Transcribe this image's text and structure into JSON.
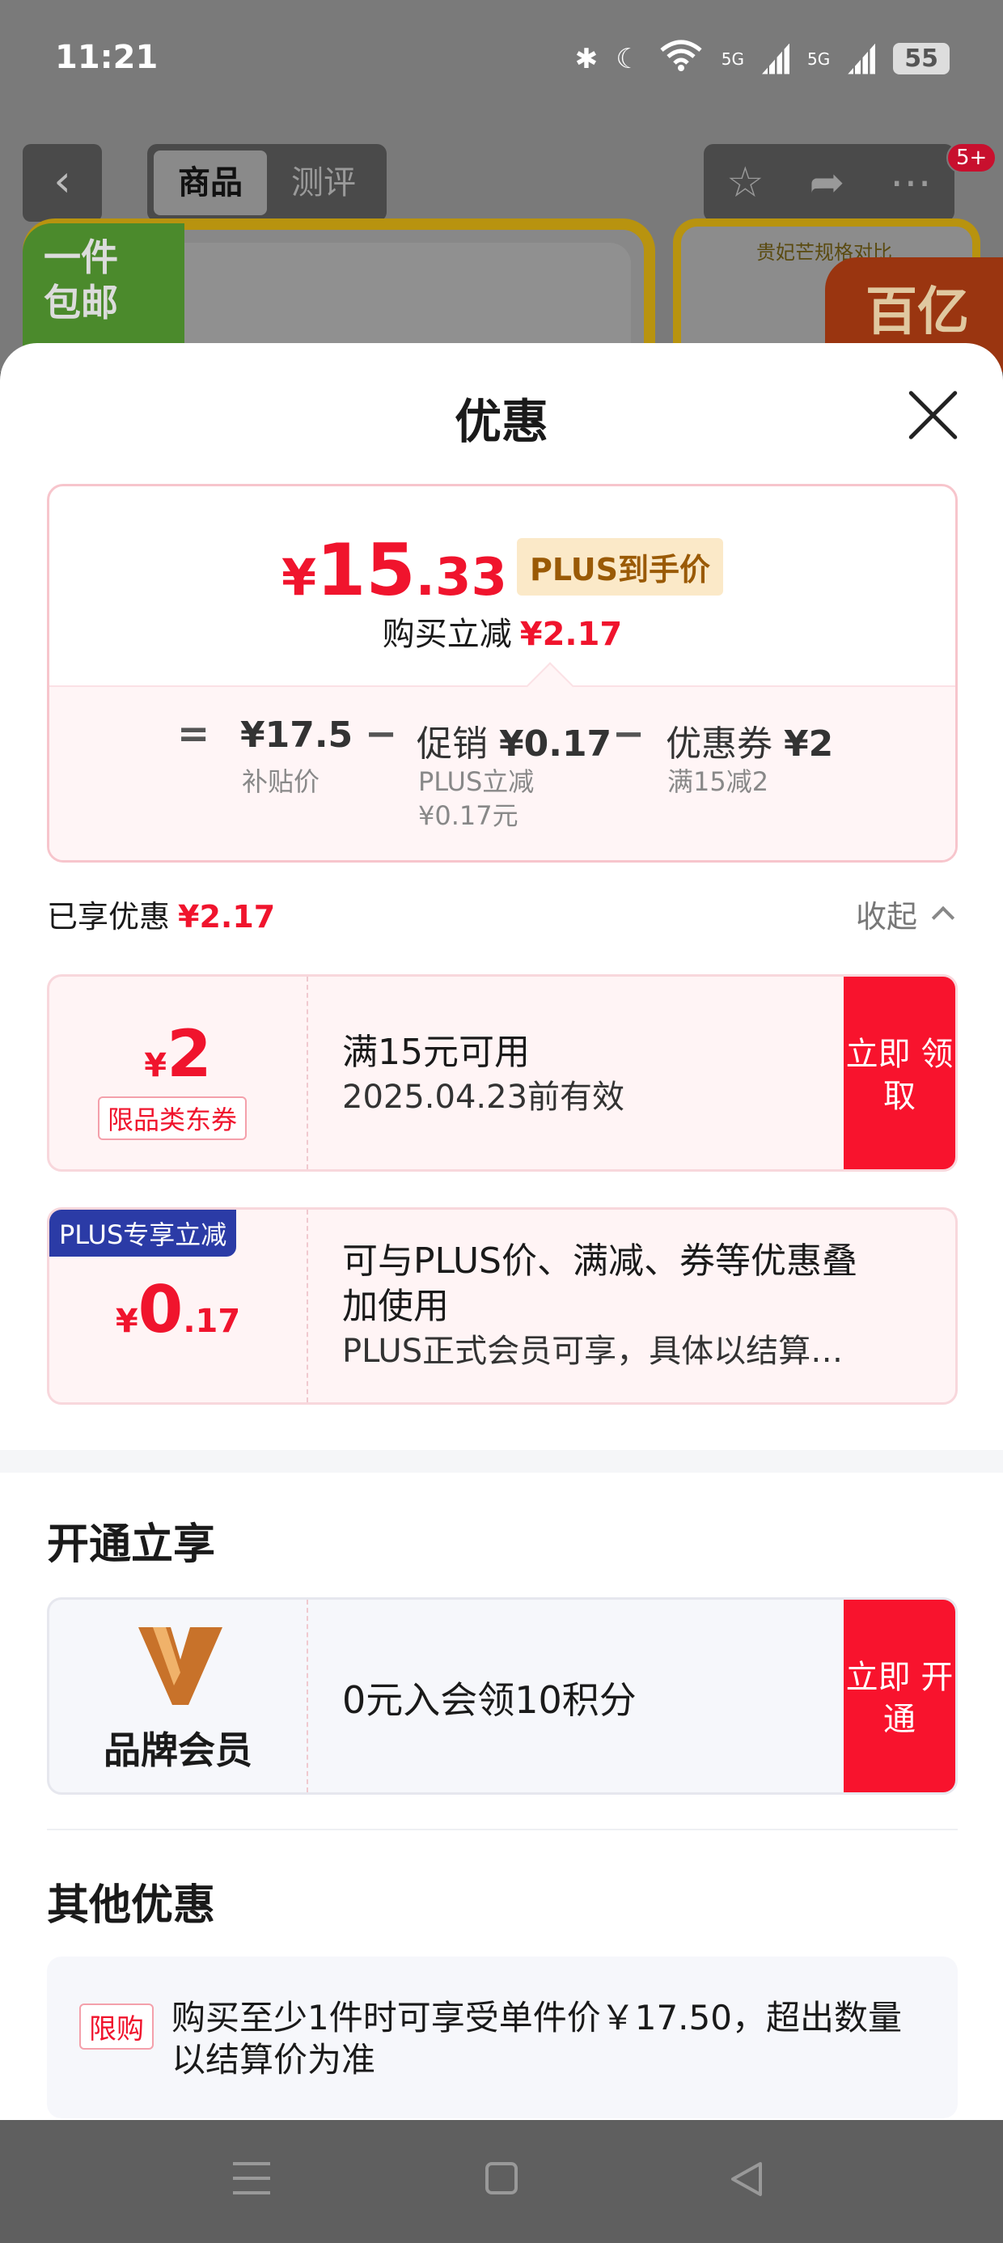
{
  "status_bar": {
    "time": "11:21",
    "network1": "5G",
    "network2": "5G",
    "battery": "55"
  },
  "background_page": {
    "tabs": [
      {
        "label": "商品",
        "active": true
      },
      {
        "label": "测评",
        "active": false
      }
    ],
    "badge": "5+",
    "ribbon": "一件 包邮",
    "card2_text": "贵妃芒规格对比",
    "card2_badge": "百亿"
  },
  "sheet": {
    "title": "优惠",
    "price": {
      "yen": "¥",
      "integer": "15",
      "decimal": ".33",
      "tag": "PLUS到手价"
    },
    "instant": {
      "label": "购买立减",
      "value": "¥2.17"
    },
    "calc": {
      "op_eq": "=",
      "subsidy_value": "¥17.5",
      "subsidy_label": "补贴价",
      "op_minus1": "−",
      "promo_prefix": "促销",
      "promo_value": "¥0.17",
      "promo_sub1": "PLUS立减",
      "promo_sub2": "¥0.17元",
      "op_minus2": "−",
      "coupon_prefix": "优惠券",
      "coupon_value": "¥2",
      "coupon_sub": "满15减2"
    },
    "enjoyed": {
      "label": "已享优惠",
      "value": "¥2.17"
    },
    "collapse_label": "收起",
    "coupon": {
      "yen": "¥",
      "amount": "2",
      "tag": "限品类东券",
      "line1": "满15元可用",
      "line2": "2025.04.23前有效",
      "button": "立即 领取"
    },
    "plus_offer": {
      "label": "PLUS专享立减",
      "yen": "¥",
      "amount": "0",
      "decimal": ".17",
      "line1": "可与PLUS价、满减、券等优惠叠加使用",
      "line2": "PLUS正式会员可享，具体以结算…"
    },
    "join_section": {
      "title": "开通立享",
      "brand": "品牌会员",
      "text": "0元入会领10积分",
      "button": "立即 开通"
    },
    "other_section": {
      "title": "其他优惠",
      "tag": "限购",
      "text": "购买至少1件时可享受单件价￥17.50，超出数量以结算价为准"
    }
  },
  "colors": {
    "accent_red": "#f0142d",
    "plus_blue": "#2b3ba6",
    "plus_gold": "#9a5a06"
  }
}
